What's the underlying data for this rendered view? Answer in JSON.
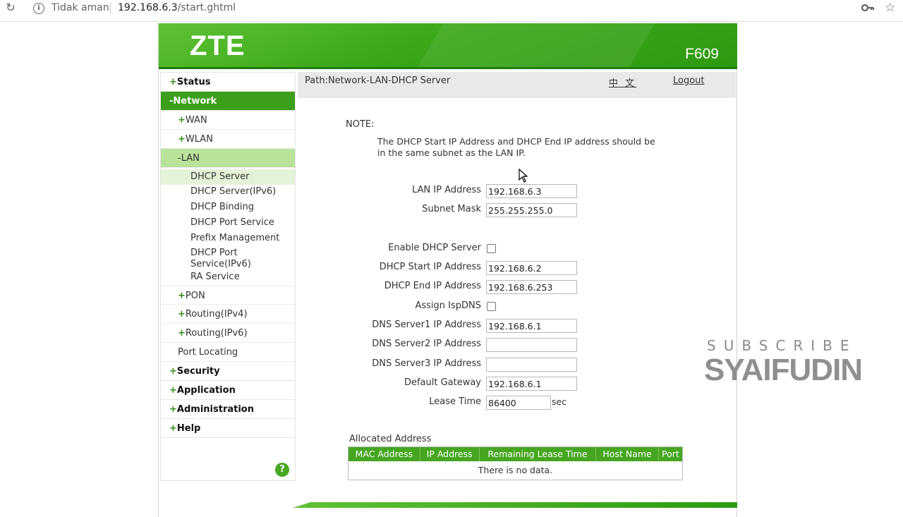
{
  "browser": {
    "security": "Tidak aman",
    "url_host": "192.168.6.3",
    "url_path": "/start.ghtml"
  },
  "header": {
    "logo": "ZTE",
    "model": "F609"
  },
  "sidebar": {
    "items": [
      {
        "label": "Status",
        "prefix": "+"
      },
      {
        "label": "Network",
        "prefix": "-"
      },
      {
        "label": "WAN",
        "prefix": "+"
      },
      {
        "label": "WLAN",
        "prefix": "+"
      },
      {
        "label": "LAN",
        "prefix": "-"
      },
      {
        "label": "DHCP Server"
      },
      {
        "label": "DHCP Server(IPv6)"
      },
      {
        "label": "DHCP Binding"
      },
      {
        "label": "DHCP Port Service"
      },
      {
        "label": "Prefix Management"
      },
      {
        "label": "DHCP Port Service(IPv6)"
      },
      {
        "label": "RA Service"
      },
      {
        "label": "PON",
        "prefix": "+"
      },
      {
        "label": "Routing(IPv4)",
        "prefix": "+"
      },
      {
        "label": "Routing(IPv6)",
        "prefix": "+"
      },
      {
        "label": "Port Locating"
      },
      {
        "label": "Security",
        "prefix": "+"
      },
      {
        "label": "Application",
        "prefix": "+"
      },
      {
        "label": "Administration",
        "prefix": "+"
      },
      {
        "label": "Help",
        "prefix": "+"
      }
    ],
    "help_icon": "?"
  },
  "content": {
    "path": "Path:Network-LAN-DHCP Server",
    "language": "中 文",
    "logout": "Logout",
    "note_title": "NOTE:",
    "note_text": "The DHCP Start IP Address and DHCP End IP address should be in the same subnet as the LAN IP.",
    "fields": {
      "lan_ip": {
        "label": "LAN IP Address",
        "value": "192.168.6.3"
      },
      "subnet": {
        "label": "Subnet Mask",
        "value": "255.255.255.0"
      },
      "enable_dhcp": {
        "label": "Enable DHCP Server",
        "checked": false
      },
      "start_ip": {
        "label": "DHCP Start IP Address",
        "value": "192.168.6.2"
      },
      "end_ip": {
        "label": "DHCP End IP Address",
        "value": "192.168.6.253"
      },
      "isp_dns": {
        "label": "Assign IspDNS",
        "checked": false
      },
      "dns1": {
        "label": "DNS Server1 IP Address",
        "value": "192.168.6.1"
      },
      "dns2": {
        "label": "DNS Server2 IP Address",
        "value": ""
      },
      "dns3": {
        "label": "DNS Server3 IP Address",
        "value": ""
      },
      "gateway": {
        "label": "Default Gateway",
        "value": "192.168.6.1"
      },
      "lease": {
        "label": "Lease Time",
        "value": "86400",
        "unit": "sec"
      }
    },
    "allocated": {
      "title": "Allocated Address",
      "columns": [
        "MAC Address",
        "IP Address",
        "Remaining Lease Time",
        "Host Name",
        "Port"
      ],
      "empty": "There is no data."
    }
  },
  "watermark": {
    "line1": "SUBSCRIBE",
    "line2": "SYAIFUDIN"
  },
  "colors": {
    "brand_green": "#3c9f1c",
    "active_light": "#b9e29b"
  }
}
